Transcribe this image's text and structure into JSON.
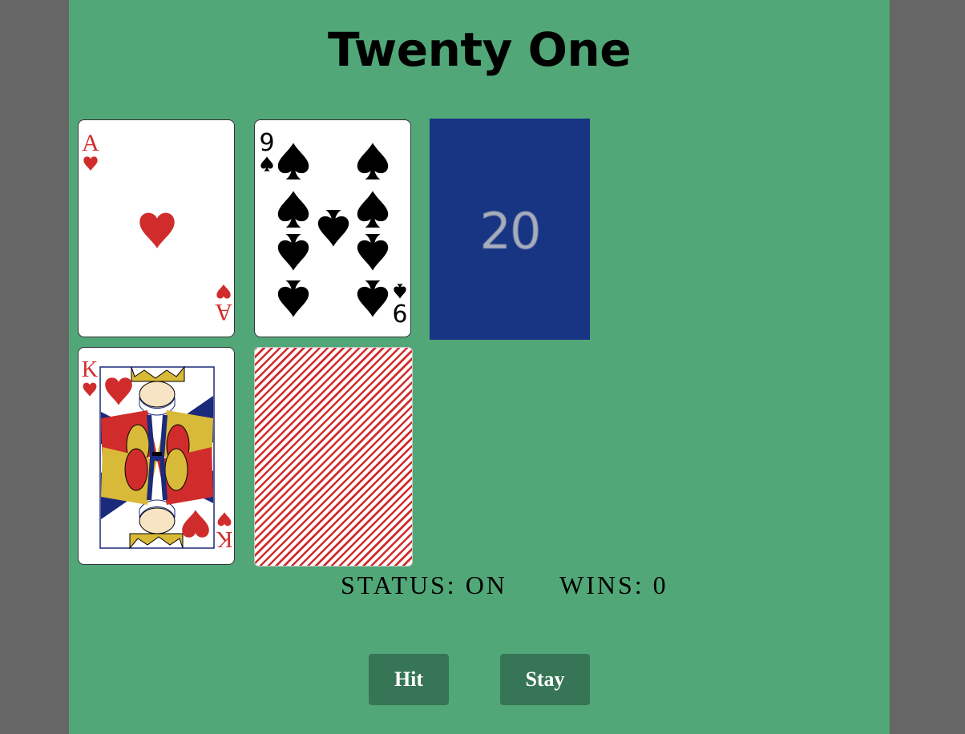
{
  "title": "Twenty One",
  "dealer": {
    "cards": [
      {
        "rank": "A",
        "suit": "hearts",
        "face": "up"
      },
      {
        "rank": "9",
        "suit": "spades",
        "face": "up"
      }
    ],
    "score": "20"
  },
  "player": {
    "cards": [
      {
        "rank": "K",
        "suit": "hearts",
        "face": "up"
      },
      {
        "suit": "hidden",
        "face": "down"
      }
    ]
  },
  "status": {
    "status_text": "STATUS: ON",
    "wins_text": "WINS: 0"
  },
  "buttons": {
    "hit_label": "Hit",
    "stay_label": "Stay"
  },
  "colors": {
    "felt": "#51a778",
    "outer": "#666666",
    "button_bg": "#367556",
    "score_tile": "#173583",
    "heart_red": "#d12c2c",
    "card_back_stripe": "#d12c2c"
  }
}
